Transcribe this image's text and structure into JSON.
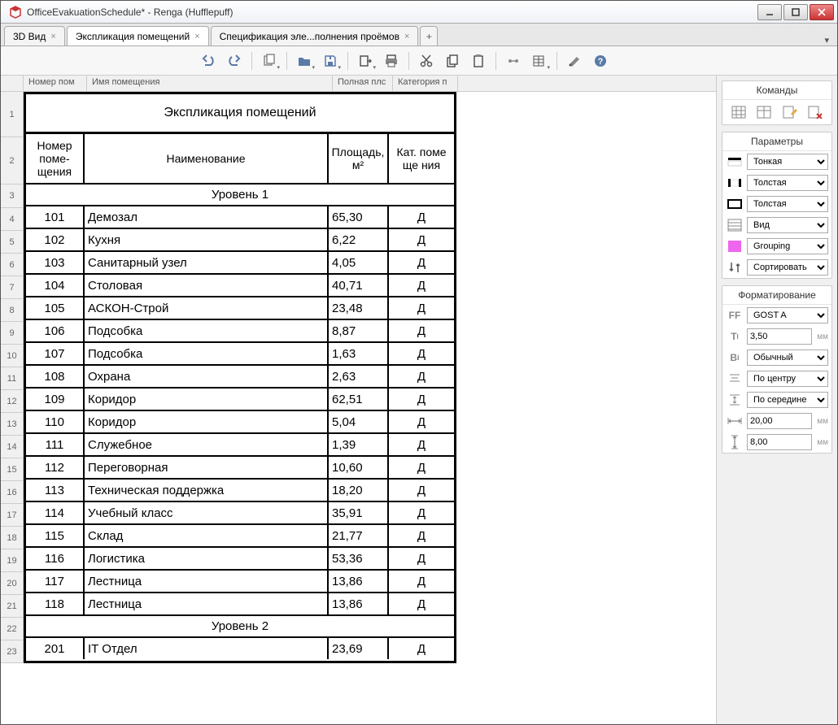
{
  "window": {
    "title": "OfficeEvakuationSchedule* - Renga (Hufflepuff)"
  },
  "tabs": {
    "t3d": "3D Вид",
    "active": "Экспликация помещений",
    "spec": "Спецификация эле...полнения проёмов"
  },
  "gridheader": {
    "c1": "Номер пом",
    "c2": "Имя помещения",
    "c3": "Полная плс",
    "c4": "Категория п"
  },
  "doc": {
    "title": "Экспликация помещений",
    "th1": "Номер поме-щения",
    "th2": "Наименование",
    "th3": "Площадь, м²",
    "th4": "Кат. поме ще ния",
    "level1": "Уровень 1",
    "level2": "Уровень 2",
    "rows": [
      {
        "n": "101",
        "name": "Демозал",
        "a": "65,30",
        "c": "Д"
      },
      {
        "n": "102",
        "name": "Кухня",
        "a": "6,22",
        "c": "Д"
      },
      {
        "n": "103",
        "name": "Санитарный узел",
        "a": "4,05",
        "c": "Д"
      },
      {
        "n": "104",
        "name": "Столовая",
        "a": "40,71",
        "c": "Д"
      },
      {
        "n": "105",
        "name": "АСКОН-Строй",
        "a": "23,48",
        "c": "Д"
      },
      {
        "n": "106",
        "name": "Подсобка",
        "a": "8,87",
        "c": "Д"
      },
      {
        "n": "107",
        "name": "Подсобка",
        "a": "1,63",
        "c": "Д"
      },
      {
        "n": "108",
        "name": "Охрана",
        "a": "2,63",
        "c": "Д"
      },
      {
        "n": "109",
        "name": "Коридор",
        "a": "62,51",
        "c": "Д"
      },
      {
        "n": "110",
        "name": "Коридор",
        "a": "5,04",
        "c": "Д"
      },
      {
        "n": "111",
        "name": "Служебное",
        "a": "1,39",
        "c": "Д"
      },
      {
        "n": "112",
        "name": "Переговорная",
        "a": "10,60",
        "c": "Д"
      },
      {
        "n": "113",
        "name": "Техническая поддержка",
        "a": "18,20",
        "c": "Д"
      },
      {
        "n": "114",
        "name": "Учебный класс",
        "a": "35,91",
        "c": "Д"
      },
      {
        "n": "115",
        "name": "Склад",
        "a": "21,77",
        "c": "Д"
      },
      {
        "n": "116",
        "name": "Логистика",
        "a": "53,36",
        "c": "Д"
      },
      {
        "n": "117",
        "name": "Лестница",
        "a": "13,86",
        "c": "Д"
      },
      {
        "n": "118",
        "name": "Лестница",
        "a": "13,86",
        "c": "Д"
      }
    ],
    "rows2": [
      {
        "n": "201",
        "name": "IT Отдел",
        "a": "23,69",
        "c": "Д"
      }
    ]
  },
  "side": {
    "commands": "Команды",
    "params": "Параметры",
    "format": "Форматирование",
    "thin": "Тонкая",
    "thick": "Толстая",
    "view": "Вид",
    "grouping": "Grouping",
    "sort": "Сортировать",
    "font": "GOST A",
    "fsize": "3,50",
    "weight": "Обычный",
    "halign": "По центру",
    "valign": "По середине",
    "w1": "20,00",
    "w2": "8,00",
    "mm": "мм"
  }
}
